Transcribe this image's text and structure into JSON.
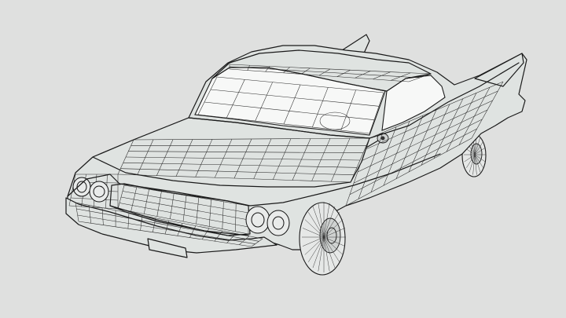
{
  "scene": {
    "background": "#dfe0df",
    "body_fill": "#dfe3e1",
    "line_color": "#1a1a1a",
    "glass_fill": "#f7f8f7"
  }
}
